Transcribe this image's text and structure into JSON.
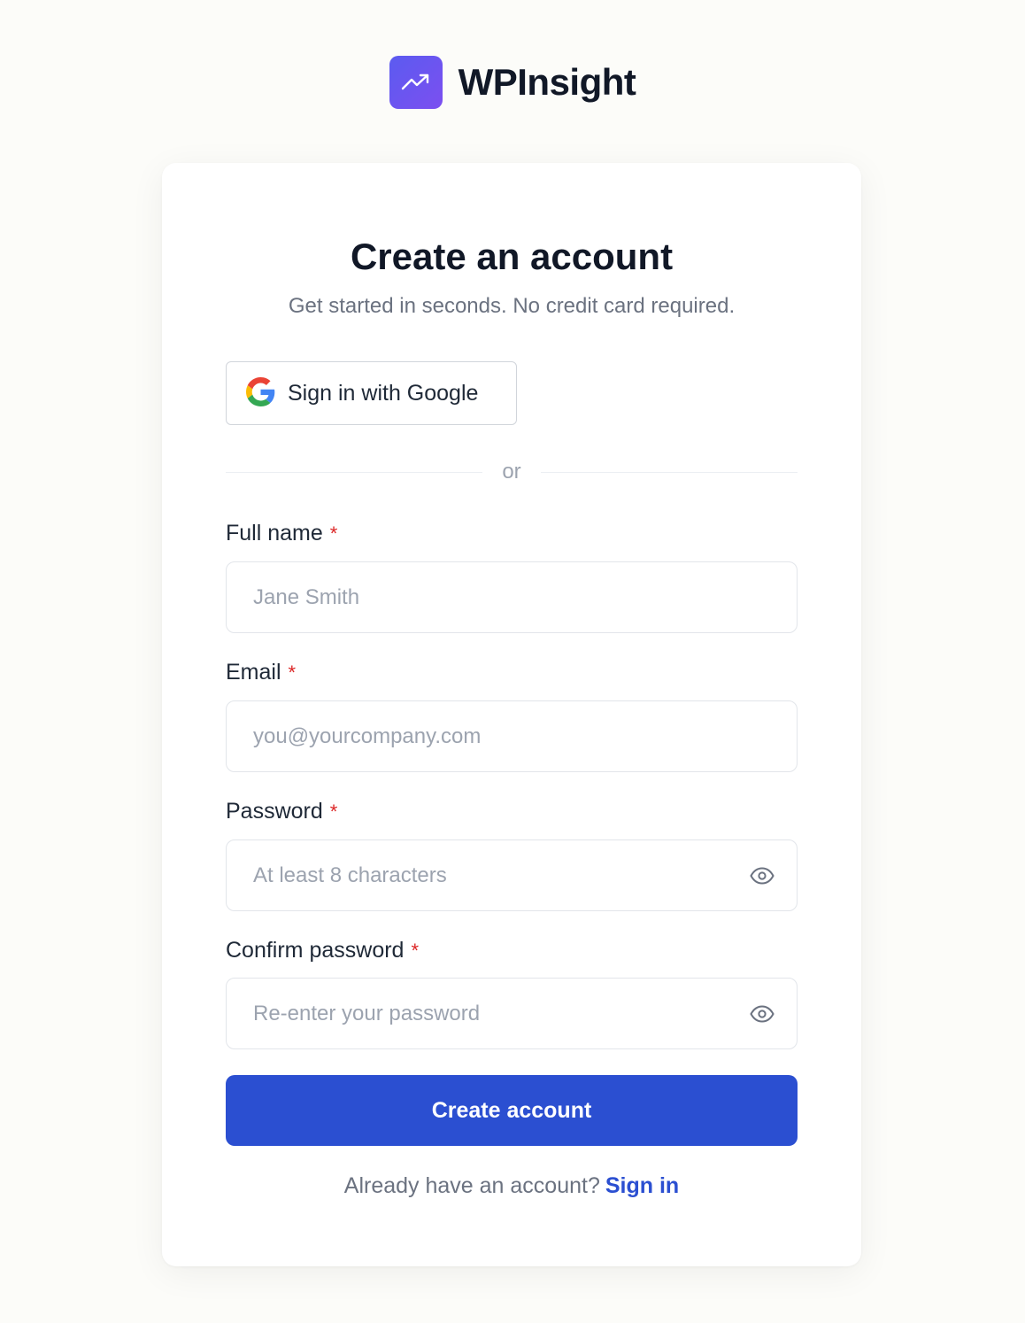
{
  "brand": {
    "name": "WPInsight",
    "icon": "trending-up-icon",
    "gradient": [
      "#5b5bf0",
      "#7c4ff0"
    ]
  },
  "form": {
    "title": "Create an account",
    "subtitle": "Get started in seconds. No credit card required.",
    "google_button_label": "Sign in with Google",
    "divider_text": "or",
    "required_marker": "*",
    "fields": {
      "full_name": {
        "label": "Full name",
        "placeholder": "Jane Smith",
        "value": ""
      },
      "email": {
        "label": "Email",
        "placeholder": "you@yourcompany.com",
        "value": ""
      },
      "password": {
        "label": "Password",
        "placeholder": "At least 8 characters",
        "value": "",
        "toggle_icon": "eye-icon"
      },
      "confirm_password": {
        "label": "Confirm password",
        "placeholder": "Re-enter your password",
        "value": "",
        "toggle_icon": "eye-icon"
      }
    },
    "submit_label": "Create account",
    "footer_text": "Already have an account?",
    "footer_link": "Sign in"
  },
  "colors": {
    "primary": "#2b4fd1",
    "required": "#dc2626",
    "background": "#fcfcf9"
  }
}
